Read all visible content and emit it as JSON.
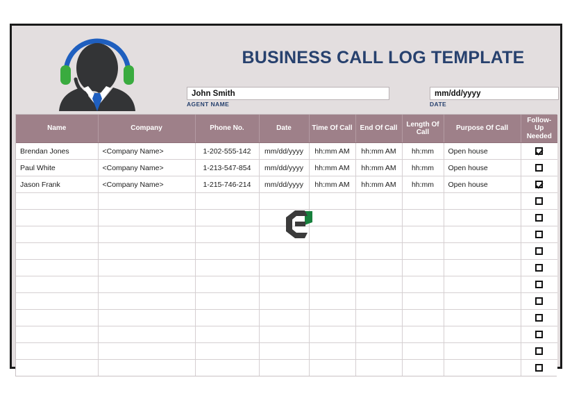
{
  "document": {
    "title": "BUSINESS CALL LOG TEMPLATE"
  },
  "header": {
    "operator_icon": "headset-operator-icon",
    "agent_field": {
      "value": "John Smith",
      "label": "AGENT NAME",
      "placeholder": "Agent name"
    },
    "date_field": {
      "value": "mm/dd/yyyy",
      "label": "DATE",
      "placeholder": "mm/dd/yyyy"
    }
  },
  "table": {
    "columns": [
      "Name",
      "Company",
      "Phone No.",
      "Date",
      "Time Of Call",
      "End Of Call",
      "Length Of Call",
      "Purpose Of Call",
      "Follow-Up Needed"
    ],
    "rows": [
      {
        "name": "Brendan Jones",
        "company": "<Company Name>",
        "phone": "1-202-555-142",
        "date": "mm/dd/yyyy",
        "time_of_call": "hh:mm AM",
        "end_of_call": "hh:mm AM",
        "length_of_call": "hh:mm",
        "purpose": "Open house",
        "follow_up": true
      },
      {
        "name": "Paul White",
        "company": "<Company Name>",
        "phone": "1-213-547-854",
        "date": "mm/dd/yyyy",
        "time_of_call": "hh:mm AM",
        "end_of_call": "hh:mm AM",
        "length_of_call": "hh:mm",
        "purpose": "Open house",
        "follow_up": false
      },
      {
        "name": "Jason Frank",
        "company": "<Company Name>",
        "phone": "1-215-746-214",
        "date": "mm/dd/yyyy",
        "time_of_call": "hh:mm AM",
        "end_of_call": "hh:mm AM",
        "length_of_call": "hh:mm",
        "purpose": "Open house",
        "follow_up": true
      },
      {
        "name": "",
        "company": "",
        "phone": "",
        "date": "",
        "time_of_call": "",
        "end_of_call": "",
        "length_of_call": "",
        "purpose": "",
        "follow_up": false
      },
      {
        "name": "",
        "company": "",
        "phone": "",
        "date": "",
        "time_of_call": "",
        "end_of_call": "",
        "length_of_call": "",
        "purpose": "",
        "follow_up": false
      },
      {
        "name": "",
        "company": "",
        "phone": "",
        "date": "",
        "time_of_call": "",
        "end_of_call": "",
        "length_of_call": "",
        "purpose": "",
        "follow_up": false
      },
      {
        "name": "",
        "company": "",
        "phone": "",
        "date": "",
        "time_of_call": "",
        "end_of_call": "",
        "length_of_call": "",
        "purpose": "",
        "follow_up": false
      },
      {
        "name": "",
        "company": "",
        "phone": "",
        "date": "",
        "time_of_call": "",
        "end_of_call": "",
        "length_of_call": "",
        "purpose": "",
        "follow_up": false
      },
      {
        "name": "",
        "company": "",
        "phone": "",
        "date": "",
        "time_of_call": "",
        "end_of_call": "",
        "length_of_call": "",
        "purpose": "",
        "follow_up": false
      },
      {
        "name": "",
        "company": "",
        "phone": "",
        "date": "",
        "time_of_call": "",
        "end_of_call": "",
        "length_of_call": "",
        "purpose": "",
        "follow_up": false
      },
      {
        "name": "",
        "company": "",
        "phone": "",
        "date": "",
        "time_of_call": "",
        "end_of_call": "",
        "length_of_call": "",
        "purpose": "",
        "follow_up": false
      },
      {
        "name": "",
        "company": "",
        "phone": "",
        "date": "",
        "time_of_call": "",
        "end_of_call": "",
        "length_of_call": "",
        "purpose": "",
        "follow_up": false
      },
      {
        "name": "",
        "company": "",
        "phone": "",
        "date": "",
        "time_of_call": "",
        "end_of_call": "",
        "length_of_call": "",
        "purpose": "",
        "follow_up": false
      },
      {
        "name": "",
        "company": "",
        "phone": "",
        "date": "",
        "time_of_call": "",
        "end_of_call": "",
        "length_of_call": "",
        "purpose": "",
        "follow_up": false
      }
    ]
  },
  "watermark": {
    "icon": "hexagon-e-logo-icon"
  },
  "colors": {
    "title": "#27416e",
    "header_row": "#9e8089",
    "page_background": "#e3dedf",
    "accent_green": "#3aab3f",
    "accent_blue": "#1f5fbf"
  }
}
